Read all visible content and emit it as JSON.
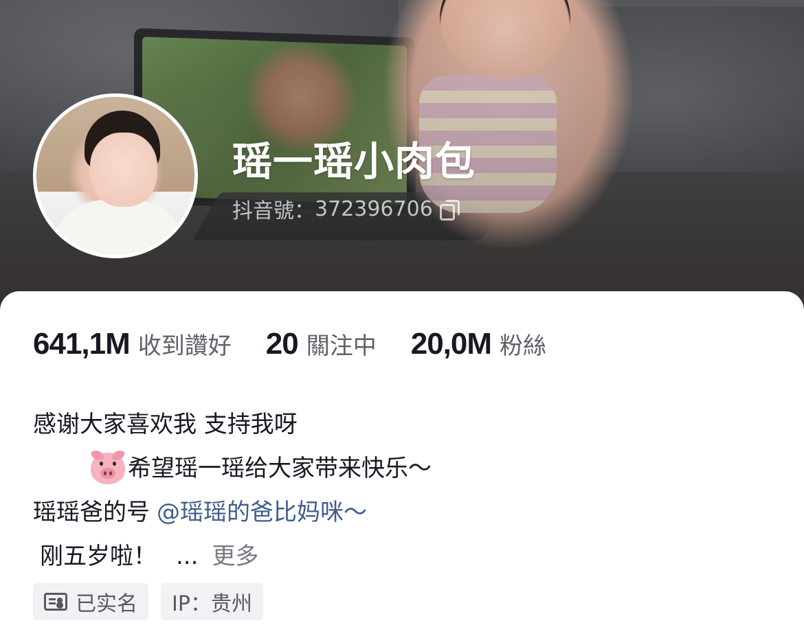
{
  "profile": {
    "nickname": "瑶一瑶小肉包",
    "douyin_id_label": "抖音號：",
    "douyin_id": "372396706",
    "copy_icon": "copy-icon"
  },
  "stats": [
    {
      "value": "641,1M",
      "label": "收到讚好"
    },
    {
      "value": "20",
      "label": "關注中"
    },
    {
      "value": "20,0M",
      "label": "粉絲"
    }
  ],
  "bio": {
    "line1": "感谢大家喜欢我 支持我呀",
    "line2_emoji": "pig-face-icon",
    "line2": "希望瑶一瑶给大家带来快乐～",
    "line3_prefix": "瑶瑶爸的号",
    "line3_mention": "@瑶瑶的爸比妈咪～",
    "line4": "刚五岁啦！",
    "ellipsis": "...",
    "more": "更多"
  },
  "tags": [
    {
      "icon": "id-card-icon",
      "label": "已实名"
    },
    {
      "label": "IP：贵州"
    }
  ],
  "colors": {
    "text_primary": "#161823",
    "text_secondary": "#5f6068",
    "mention": "#3e5d8a",
    "tag_bg": "#f2f2f4"
  }
}
